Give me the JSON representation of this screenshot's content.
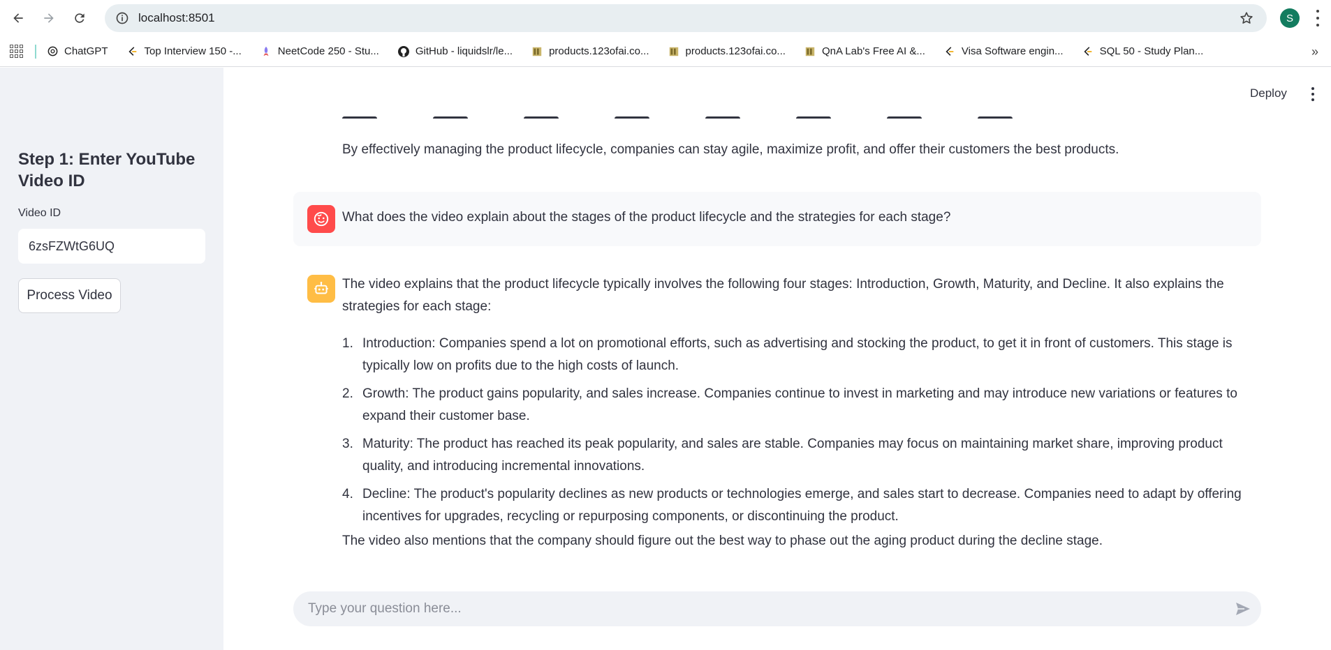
{
  "browser": {
    "url": "localhost:8501",
    "profile_initial": "S",
    "bookmarks": [
      {
        "label": "ChatGPT",
        "icon": "chatgpt-icon"
      },
      {
        "label": "Top Interview 150 -...",
        "icon": "leetcode-icon"
      },
      {
        "label": "NeetCode 250 - Stu...",
        "icon": "rocket-icon"
      },
      {
        "label": "GitHub - liquidslr/le...",
        "icon": "github-icon"
      },
      {
        "label": "products.123ofai.co...",
        "icon": "site-icon"
      },
      {
        "label": "products.123ofai.co...",
        "icon": "site-icon"
      },
      {
        "label": "QnA Lab's Free AI &...",
        "icon": "site-icon"
      },
      {
        "label": "Visa Software engin...",
        "icon": "leetcode-icon"
      },
      {
        "label": "SQL 50 - Study Plan...",
        "icon": "leetcode-icon"
      }
    ]
  },
  "sidebar": {
    "title": "Step 1: Enter YouTube Video ID",
    "video_id_label": "Video ID",
    "video_id_value": "6zsFZWtG6UQ",
    "process_button": "Process Video"
  },
  "header": {
    "deploy_label": "Deploy"
  },
  "chat": {
    "previous_text": "By effectively managing the product lifecycle, companies can stay agile, maximize profit, and offer their customers the best products.",
    "user_question": "What does the video explain about the stages of the product lifecycle and the strategies for each stage?",
    "bot_intro": "The video explains that the product lifecycle typically involves the following four stages: Introduction, Growth, Maturity, and Decline. It also explains the strategies for each stage:",
    "bot_items": [
      {
        "num": "1.",
        "text": "Introduction: Companies spend a lot on promotional efforts, such as advertising and stocking the product, to get it in front of customers. This stage is typically low on profits due to the high costs of launch."
      },
      {
        "num": "2.",
        "text": "Growth: The product gains popularity, and sales increase. Companies continue to invest in marketing and may introduce new variations or features to expand their customer base."
      },
      {
        "num": "3.",
        "text": "Maturity: The product has reached its peak popularity, and sales are stable. Companies may focus on maintaining market share, improving product quality, and introducing incremental innovations."
      },
      {
        "num": "4.",
        "text": "Decline: The product's popularity declines as new products or technologies emerge, and sales start to decrease. Companies need to adapt by offering incentives for upgrades, recycling or repurposing components, or discontinuing the product."
      }
    ],
    "bot_footer": "The video also mentions that the company should figure out the best way to phase out the aging product during the decline stage.",
    "input_placeholder": "Type your question here..."
  },
  "colors": {
    "sidebar_bg": "#f0f2f6",
    "user_avatar": "#ff4b4b",
    "bot_avatar": "#ffbd45",
    "text": "#31333f"
  }
}
